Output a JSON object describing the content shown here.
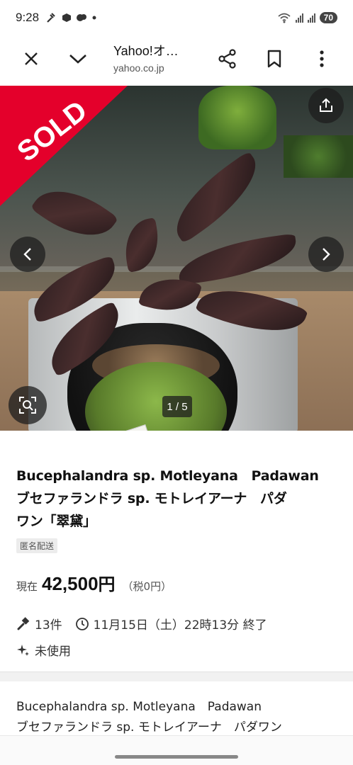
{
  "status_bar": {
    "time": "9:28",
    "battery": "70"
  },
  "toolbar": {
    "title": "Yahoo!オ…",
    "url": "yahoo.co.jp",
    "icons": [
      "close-icon",
      "chevron-down-icon",
      "share-icon",
      "bookmark-icon",
      "more-vert-icon"
    ]
  },
  "hero": {
    "sold_label": "SOLD",
    "page_counter": "1 / 5"
  },
  "listing": {
    "title_line1": "Bucephalandra sp. Motleyana　Padawan",
    "title_line2": "ブセファランドラ sp. モトレイアーナ　パダ",
    "title_line3": "ワン「翠黛」",
    "badge": "匿名配送",
    "price_label": "現在",
    "price": "42,500",
    "price_unit": "円",
    "tax": "（税0円）",
    "bids": "13件",
    "end_time": "11月15日（土）22時13分 終了",
    "condition": "未使用"
  },
  "description": {
    "line1": "Bucephalandra sp. Motleyana　Padawan",
    "line2": "ブセファランドラ sp. モトレイアーナ　パダワン"
  },
  "colors": {
    "sold_red": "#e4002b",
    "text": "#1a1a1a"
  }
}
